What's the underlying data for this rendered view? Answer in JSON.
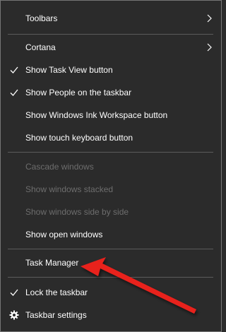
{
  "menu": {
    "items": [
      {
        "label": "Toolbars",
        "submenu": true
      },
      {
        "label": "Cortana",
        "submenu": true
      },
      {
        "label": "Show Task View button",
        "checked": true
      },
      {
        "label": "Show People on the taskbar",
        "checked": true
      },
      {
        "label": "Show Windows Ink Workspace button",
        "checked": false
      },
      {
        "label": "Show touch keyboard button",
        "checked": false
      },
      {
        "label": "Cascade windows",
        "enabled": false
      },
      {
        "label": "Show windows stacked",
        "enabled": false
      },
      {
        "label": "Show windows side by side",
        "enabled": false
      },
      {
        "label": "Show open windows",
        "enabled": true
      },
      {
        "label": "Task Manager"
      },
      {
        "label": "Lock the taskbar",
        "checked": true
      },
      {
        "label": "Taskbar settings",
        "icon": "gear-icon"
      }
    ]
  },
  "colors": {
    "background": "#2b2b2b",
    "text": "#ffffff",
    "disabled_text": "#6d6d6d",
    "separator": "#5c5c5c",
    "annotation_arrow": "#e8201f"
  },
  "annotation": {
    "type": "arrow",
    "points_to": "Task Manager"
  }
}
